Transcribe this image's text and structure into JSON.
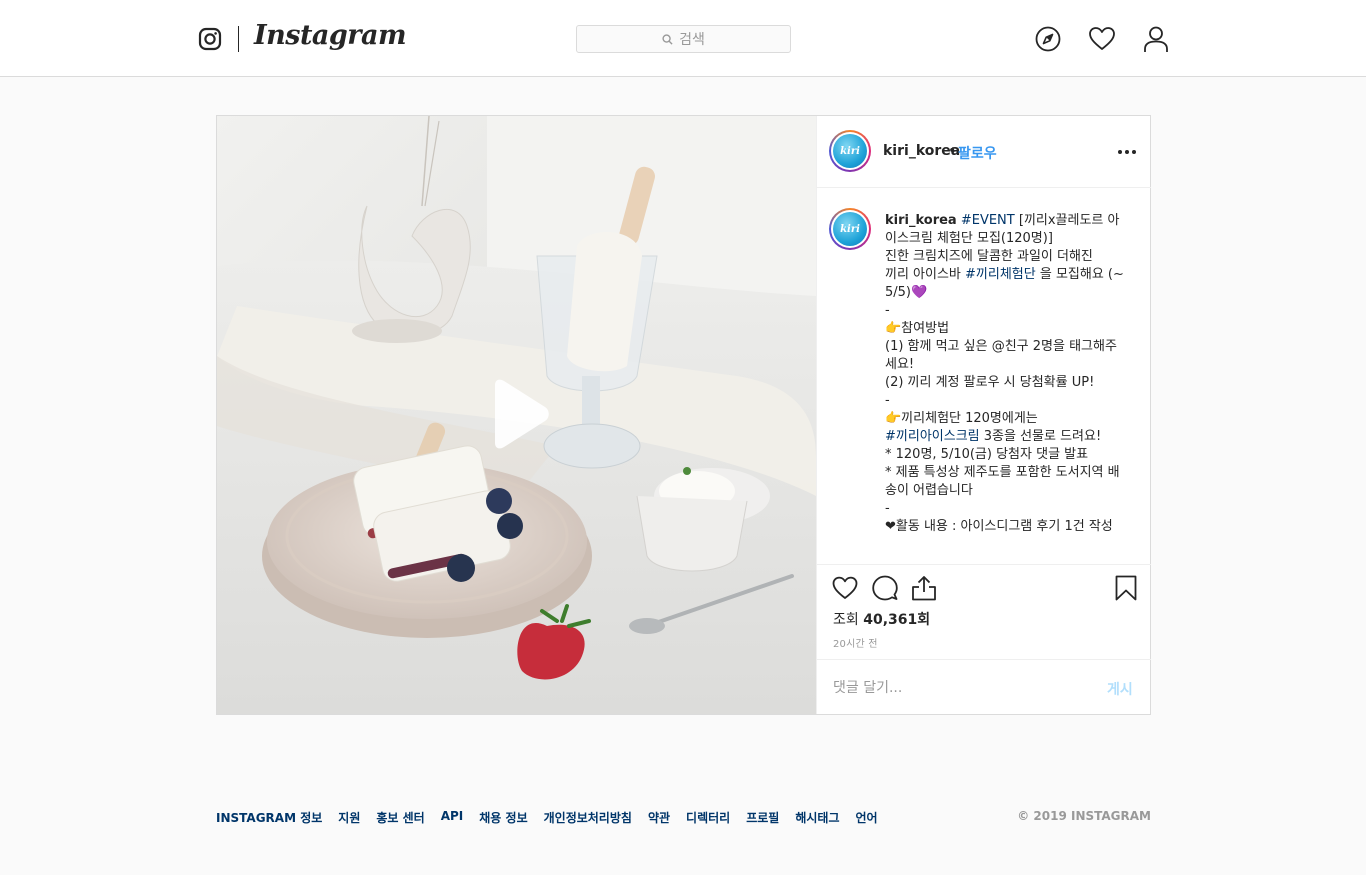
{
  "header": {
    "logo_text": "Instagram",
    "search_placeholder": "검색"
  },
  "post": {
    "username": "kiri_korea",
    "separator": "•",
    "follow_label": "팔로우",
    "avatar_text": "kiri",
    "caption": {
      "username": "kiri_korea",
      "segments": [
        {
          "text": " ",
          "tag": false
        },
        {
          "text": "#EVENT",
          "tag": true
        },
        {
          "text": " [끼리x끌레도르 아이스크림 체험단 모집(120명)]\n진한 크림치즈에 달콤한 과일이 더해진\n끼리 아이스바 ",
          "tag": false
        },
        {
          "text": "#끼리체험단",
          "tag": true
        },
        {
          "text": " 을 모집해요 (~5/5)💜\n-\n👉참여방법\n(1) 함께 먹고 싶은 @친구 2명을 태그해주세요!\n(2) 끼리 계정 팔로우 시 당첨확률 UP!\n-\n👉끼리체험단 120명에게는\n",
          "tag": false
        },
        {
          "text": "#끼리아이스크림",
          "tag": true
        },
        {
          "text": " 3종을 선물로 드려요!\n* 120명, 5/10(금) 당첨자 댓글 발표\n* 제품 특성상 제주도를 포함한 도서지역 배송이 어렵습니다\n-\n❤활동 내용 : 아이스디그램 후기 1건 작성",
          "tag": false
        }
      ]
    },
    "views_label": "조회",
    "views_count": "40,361회",
    "time_ago": "20시간 전",
    "comment_placeholder": "댓글 달기...",
    "post_button": "게시"
  },
  "footer": {
    "links": [
      "INSTAGRAM 정보",
      "지원",
      "홍보 센터",
      "API",
      "채용 정보",
      "개인정보처리방침",
      "약관",
      "디렉터리",
      "프로필",
      "해시태그",
      "언어"
    ],
    "copyright": "© 2019 INSTAGRAM"
  },
  "colors": {
    "link_blue": "#3897f0",
    "hashtag": "#003569",
    "muted": "#999999",
    "border": "#dbdbdb"
  },
  "icons": {
    "header": [
      "instagram-camera-icon",
      "search-icon",
      "explore-compass-icon",
      "activity-heart-icon",
      "profile-icon"
    ],
    "actions": [
      "like-heart-icon",
      "comment-bubble-icon",
      "share-icon",
      "save-bookmark-icon"
    ],
    "media": [
      "play-icon"
    ]
  }
}
